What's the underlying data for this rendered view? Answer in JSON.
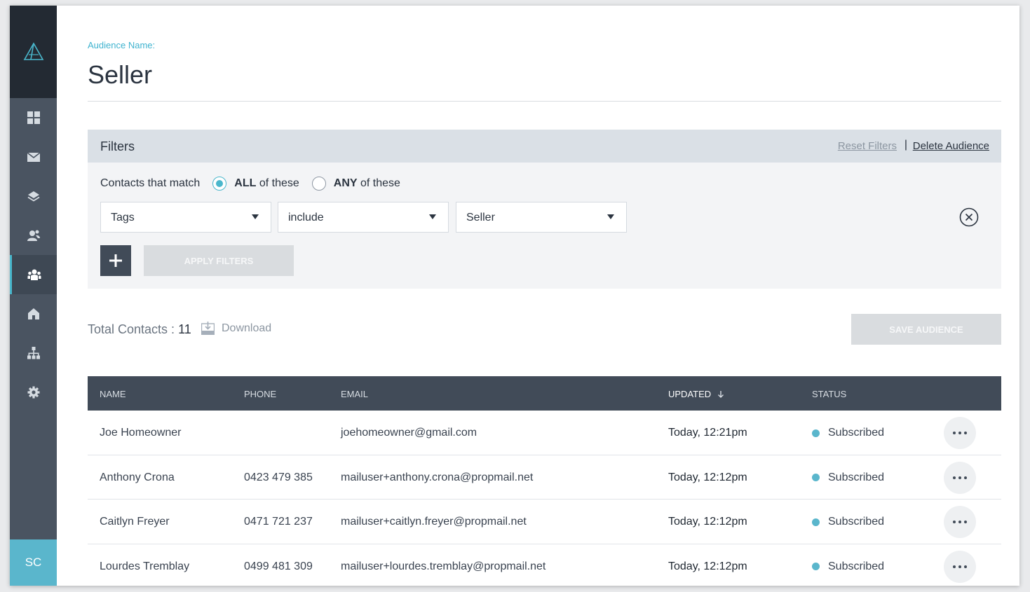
{
  "sidebar": {
    "avatar_initials": "SC",
    "accent_color": "#5ab6cc",
    "items": [
      {
        "icon": "dashboard-icon"
      },
      {
        "icon": "mail-icon"
      },
      {
        "icon": "layers-icon"
      },
      {
        "icon": "contacts-icon"
      },
      {
        "icon": "audiences-icon",
        "active": true
      },
      {
        "icon": "home-icon"
      },
      {
        "icon": "hierarchy-icon"
      },
      {
        "icon": "gear-icon"
      }
    ]
  },
  "header": {
    "audience_label": "Audience Name:",
    "audience_name": "Seller"
  },
  "filters": {
    "title": "Filters",
    "reset_label": "Reset Filters",
    "separator": "|",
    "delete_label": "Delete Audience",
    "match_prefix": "Contacts that match",
    "option_all_bold": "ALL",
    "option_all_rest": " of these",
    "option_any_bold": "ANY",
    "option_any_rest": " of these",
    "selected_option": "ALL",
    "field_value": "Tags",
    "operator_value": "include",
    "tag_value": "Seller",
    "apply_label": "APPLY FILTERS"
  },
  "summary": {
    "total_label": "Total Contacts :",
    "total_count": "11",
    "download_label": "Download",
    "save_label": "SAVE AUDIENCE"
  },
  "table": {
    "columns": {
      "name": "NAME",
      "phone": "PHONE",
      "email": "EMAIL",
      "updated": "UPDATED",
      "status": "STATUS"
    },
    "rows": [
      {
        "name": "Joe Homeowner",
        "phone": "",
        "email": "joehomeowner@gmail.com",
        "updated": "Today, 12:21pm",
        "status": "Subscribed"
      },
      {
        "name": "Anthony Crona",
        "phone": "0423 479 385",
        "email": "mailuser+anthony.crona@propmail.net",
        "updated": "Today, 12:12pm",
        "status": "Subscribed"
      },
      {
        "name": "Caitlyn Freyer",
        "phone": "0471 721 237",
        "email": "mailuser+caitlyn.freyer@propmail.net",
        "updated": "Today, 12:12pm",
        "status": "Subscribed"
      },
      {
        "name": "Lourdes Tremblay",
        "phone": "0499 481 309",
        "email": "mailuser+lourdes.tremblay@propmail.net",
        "updated": "Today, 12:12pm",
        "status": "Subscribed"
      }
    ]
  }
}
